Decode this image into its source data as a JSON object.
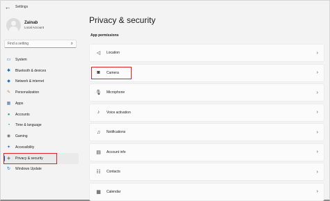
{
  "window": {
    "title": "Settings",
    "back": "←"
  },
  "profile": {
    "name": "Zainab",
    "account_type": "Local Account"
  },
  "search": {
    "placeholder": "Find a setting",
    "icon": "search-icon"
  },
  "sidebar": {
    "items": [
      {
        "label": "System",
        "icon": "monitor-icon",
        "glyph": "▭",
        "color": "#0067c0"
      },
      {
        "label": "Bluetooth & devices",
        "icon": "bluetooth-icon",
        "glyph": "✱",
        "color": "#0067c0"
      },
      {
        "label": "Network & internet",
        "icon": "wifi-icon",
        "glyph": "◆",
        "color": "#1e6fcc"
      },
      {
        "label": "Personalization",
        "icon": "brush-icon",
        "glyph": "✎",
        "color": "#d47b2a"
      },
      {
        "label": "Apps",
        "icon": "apps-icon",
        "glyph": "▦",
        "color": "#4a6fa5"
      },
      {
        "label": "Accounts",
        "icon": "person-icon",
        "glyph": "●",
        "color": "#2ca25f"
      },
      {
        "label": "Time & language",
        "icon": "globe-clock-icon",
        "glyph": "◔",
        "color": "#0067c0"
      },
      {
        "label": "Gaming",
        "icon": "gamepad-icon",
        "glyph": "◉",
        "color": "#6b6b6b"
      },
      {
        "label": "Accessibility",
        "icon": "accessibility-icon",
        "glyph": "✦",
        "color": "#1e6fcc"
      },
      {
        "label": "Privacy & security",
        "icon": "shield-icon",
        "glyph": "◈",
        "color": "#6b6b6b",
        "active": true
      },
      {
        "label": "Windows Update",
        "icon": "update-icon",
        "glyph": "↻",
        "color": "#0067c0"
      }
    ]
  },
  "main": {
    "title": "Privacy & security",
    "section": "App permissions",
    "rows": [
      {
        "label": "Location",
        "icon": "location-icon",
        "glyph": "◁"
      },
      {
        "label": "Camera",
        "icon": "camera-icon",
        "glyph": "◙"
      },
      {
        "label": "Microphone",
        "icon": "microphone-icon",
        "glyph": "🎙"
      },
      {
        "label": "Voice activation",
        "icon": "voice-icon",
        "glyph": "♪"
      },
      {
        "label": "Notifications",
        "icon": "bell-icon",
        "glyph": "♫"
      },
      {
        "label": "Account info",
        "icon": "account-card-icon",
        "glyph": "▤"
      },
      {
        "label": "Contacts",
        "icon": "contacts-icon",
        "glyph": "☷"
      },
      {
        "label": "Calendar",
        "icon": "calendar-icon",
        "glyph": "▦"
      }
    ],
    "chevron": "›"
  },
  "colors": {
    "accent": "#0067c0",
    "highlight": "#e02424"
  }
}
